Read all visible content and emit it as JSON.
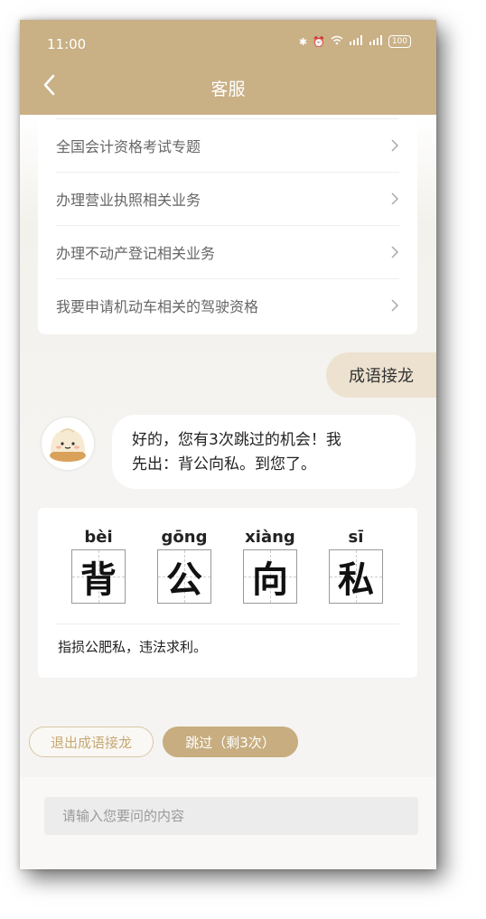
{
  "status": {
    "time": "11:00",
    "battery": "100"
  },
  "header": {
    "title": "客服"
  },
  "menu": {
    "items": [
      {
        "label": "全国会计资格考试专题"
      },
      {
        "label": "办理营业执照相关业务"
      },
      {
        "label": "办理不动产登记相关业务"
      },
      {
        "label": "我要申请机动车相关的驾驶资格"
      }
    ]
  },
  "chat": {
    "user_message": "成语接龙",
    "bot_message_line1": "好的，您有3次跳过的机会！我",
    "bot_message_line2": "先出：背公向私。到您了。"
  },
  "idiom": {
    "chars": [
      {
        "pinyin": "bèi",
        "char": "背"
      },
      {
        "pinyin": "gōng",
        "char": "公"
      },
      {
        "pinyin": "xiàng",
        "char": "向"
      },
      {
        "pinyin": "sī",
        "char": "私"
      }
    ],
    "meaning": "指损公肥私，违法求利。"
  },
  "actions": {
    "exit_label": "退出成语接龙",
    "skip_label": "跳过（剩3次）"
  },
  "input": {
    "placeholder": "请输入您要问的内容"
  },
  "colors": {
    "accent": "#c9b085",
    "user_bubble": "#ece2cf"
  }
}
